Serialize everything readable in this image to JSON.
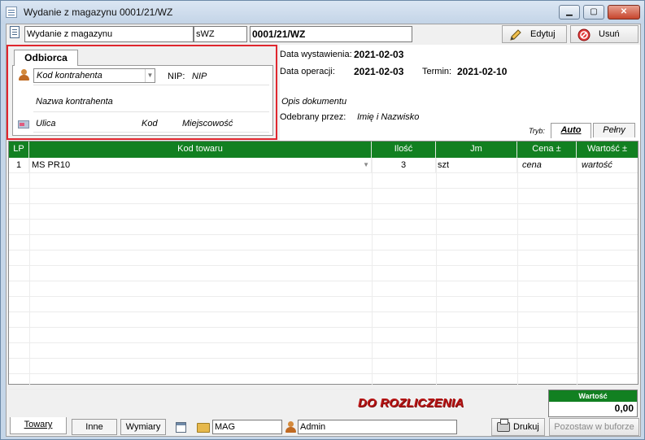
{
  "window": {
    "title": "Wydanie z magazynu 0001/21/WZ",
    "controls": {
      "minimize": "▁",
      "maximize": "▢",
      "close": "✕"
    }
  },
  "toolbar": {
    "doc_type": "Wydanie z magazynu",
    "series": "sWZ",
    "number": "0001/21/WZ",
    "edit_label": "Edytuj",
    "delete_label": "Usuń"
  },
  "recipient": {
    "tab_label": "Odbiorca",
    "contractor_code_placeholder": "Kod kontrahenta",
    "nip_label": "NIP:",
    "nip_value": "NIP",
    "name_placeholder": "Nazwa kontrahenta",
    "street": "Ulica",
    "postal_code": "Kod",
    "city": "Miejscowość"
  },
  "document_info": {
    "issue_date_label": "Data wystawienia:",
    "issue_date": "2021-02-03",
    "operation_date_label": "Data operacji:",
    "operation_date": "2021-02-03",
    "due_label": "Termin:",
    "due_date": "2021-02-10",
    "description_placeholder": "Opis dokumentu",
    "received_by_label": "Odebrany przez:",
    "received_by_placeholder": "Imię i Nazwisko",
    "mode_label": "Tryb:",
    "mode_tabs": [
      "Auto",
      "Pełny"
    ]
  },
  "grid": {
    "columns": [
      "LP",
      "Kod towaru",
      "Ilość",
      "Jm",
      "Cena ±",
      "Wartość ±"
    ],
    "rows": [
      {
        "lp": "1",
        "code": "MS PR10",
        "qty": "3",
        "unit": "szt",
        "price": "cena",
        "value": "wartość"
      }
    ]
  },
  "summary": {
    "status": "DO ROZLICZENIA",
    "value_label": "Wartość",
    "value": "0,00"
  },
  "bottom": {
    "tabs": [
      "Towary",
      "Inne",
      "Wymiary"
    ],
    "warehouse": "MAG",
    "user": "Admin",
    "print_label": "Drukuj",
    "leave_label": "Pozostaw w buforze"
  },
  "colors": {
    "accent_green": "#128021",
    "status_red": "#b81414",
    "highlight_border": "#e0262e"
  }
}
